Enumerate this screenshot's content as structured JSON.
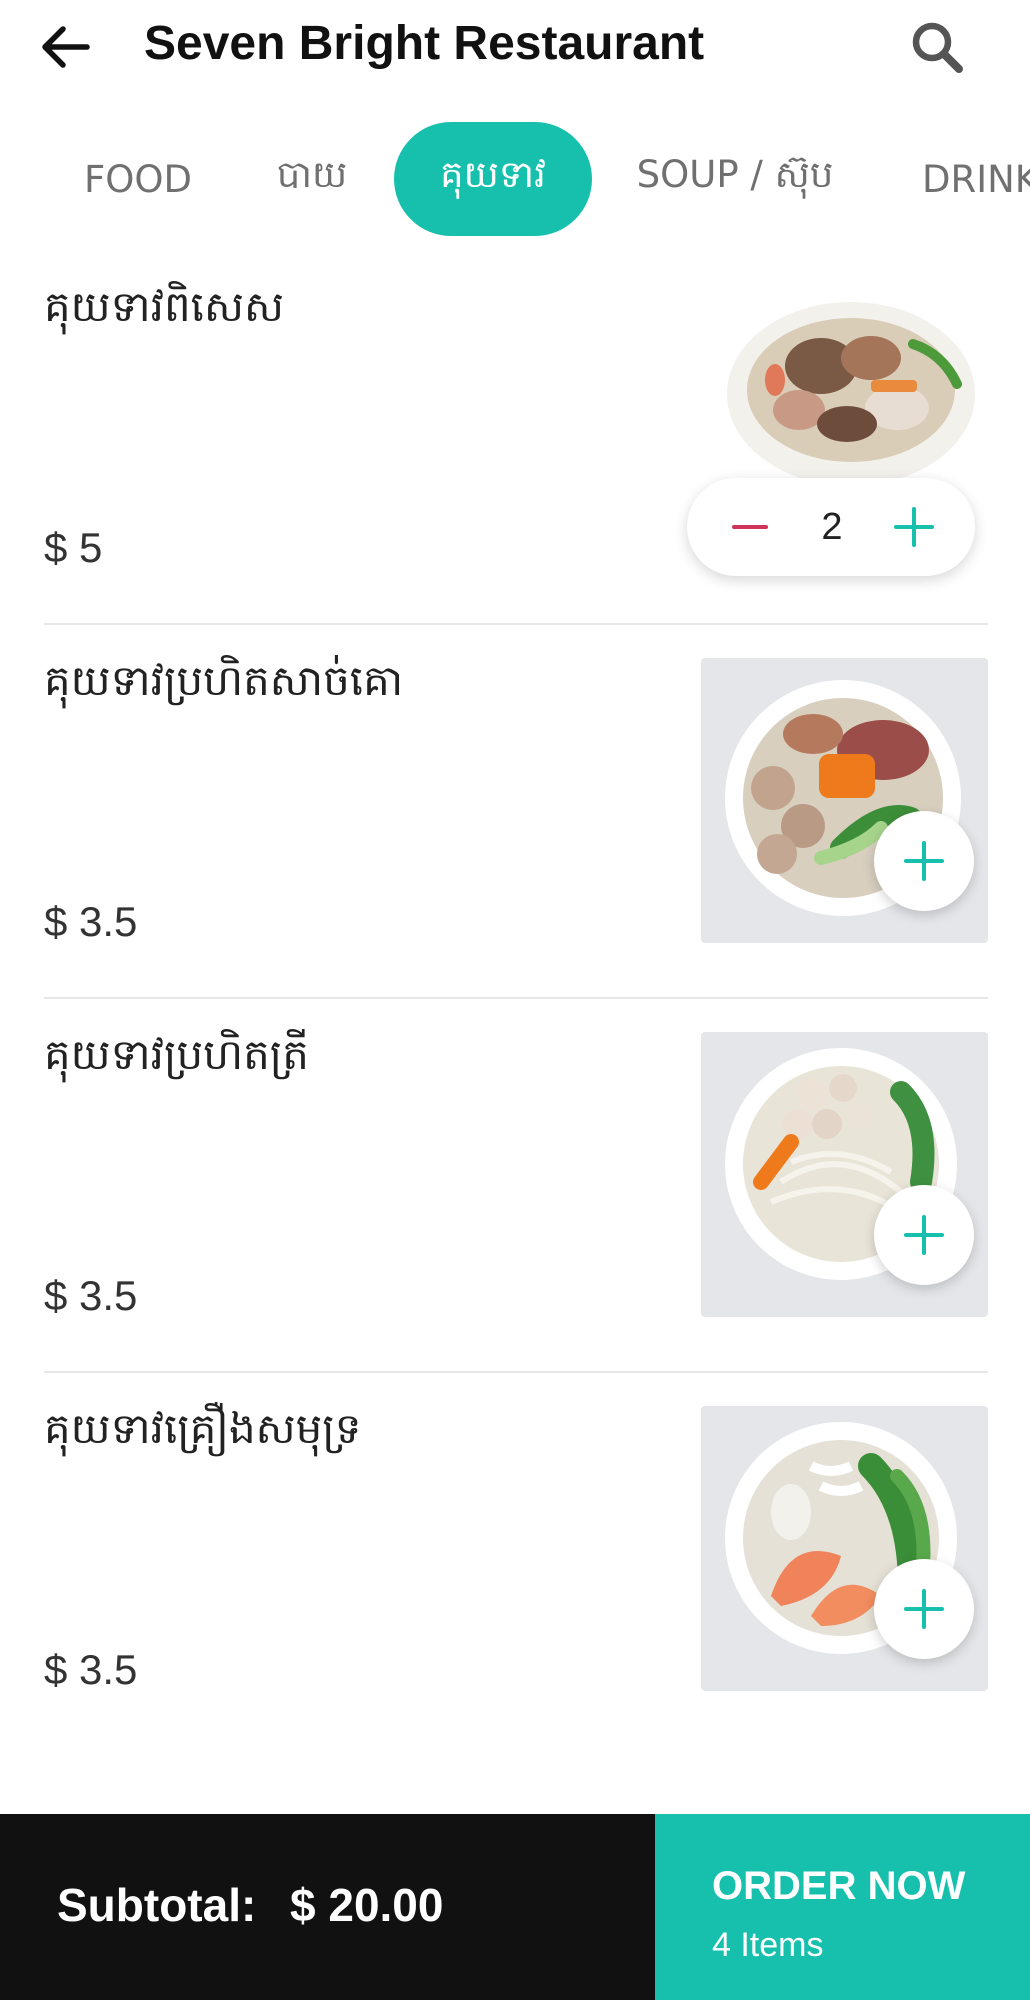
{
  "header": {
    "title": "Seven Bright Restaurant",
    "back_icon": "arrow-left-icon",
    "search_icon": "search-icon"
  },
  "tabs": [
    {
      "label": "FOOD",
      "active": false
    },
    {
      "label": "បាយ",
      "active": false
    },
    {
      "label": "គុយទាវ",
      "active": true
    },
    {
      "label": "SOUP / ស៊ុប",
      "active": false
    },
    {
      "label": "DRINK",
      "active": false
    }
  ],
  "items": [
    {
      "name": "គុយទាវពិសេស",
      "price": "$ 5",
      "quantity": "2",
      "image": "noodle-soup-special-image"
    },
    {
      "name": "គុយទាវប្រហិតសាច់គោ",
      "price": "$ 3.5",
      "image": "beef-ball-noodle-soup-image"
    },
    {
      "name": "គុយទាវប្រហិតត្រី",
      "price": "$ 3.5",
      "image": "fish-ball-noodle-soup-image"
    },
    {
      "name": "គុយទាវគ្រឿងសមុទ្រ",
      "price": "$ 3.5",
      "image": "seafood-noodle-soup-image"
    }
  ],
  "footer": {
    "subtotal_label": "Subtotal:",
    "subtotal_value": "$ 20.00",
    "order_label": "ORDER NOW",
    "order_count": "4 Items"
  },
  "colors": {
    "accent": "#16c0ad",
    "minus": "#d0325a",
    "footer_bg": "#111111"
  }
}
